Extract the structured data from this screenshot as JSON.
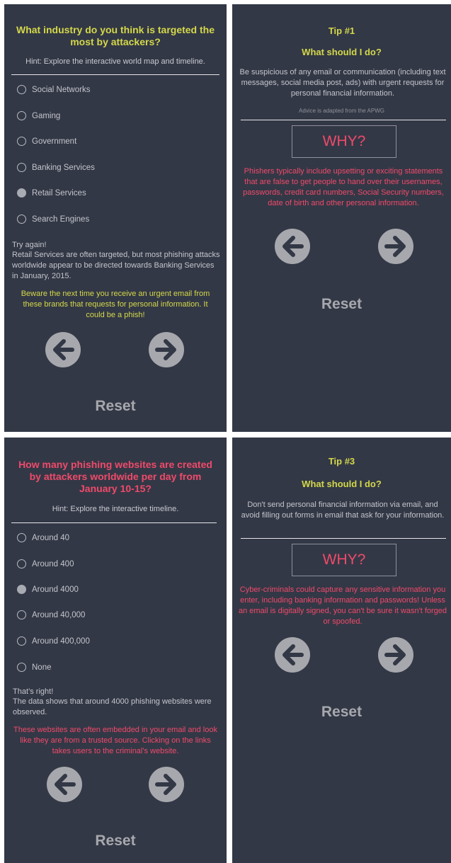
{
  "panel1": {
    "question": "What industry do you think is targeted the most by attackers?",
    "hint": "Hint: Explore the interactive world map and timeline.",
    "options": [
      "Social Networks",
      "Gaming",
      "Government",
      "Banking Services",
      "Retail Services",
      "Search Engines"
    ],
    "selected": "Retail Services",
    "feedback_line1": "Try again!",
    "feedback_body": "Retail Services are often targeted, but most phishing attacks worldwide appear to be directed towards Banking Services in January, 2015.",
    "note": "Beware the next time you receive an urgent email from these brands that requests for personal information. It could be a phish!",
    "reset_label": "Reset"
  },
  "panel2": {
    "tip_number": "Tip #1",
    "tip_title": "What should I do?",
    "tip_body": "Be suspicious of any email or communication (including text messages, social media post, ads) with urgent requests for personal financial information.",
    "advice_note": "Advice is adapted from the APWG",
    "why_label": "WHY?",
    "why_body": "Phishers typically include upsetting or exciting statements that are false to get people to hand over their usernames, passwords, credit card numbers, Social Security numbers, date of birth and other personal information.",
    "reset_label": "Reset"
  },
  "panel3": {
    "question": "How many phishing websites are created by attackers worldwide per day from January 10-15?",
    "hint": "Hint: Explore the interactive timeline.",
    "options": [
      "Around 40",
      "Around 400",
      "Around 4000",
      "Around 40,000",
      "Around 400,000",
      "None"
    ],
    "selected": "Around 4000",
    "feedback_line1": "That’s right!",
    "feedback_body": "The data shows that around 4000 phishing websites were observed.",
    "note": "These websites are often embedded in your email and look like they are from a trusted source. Clicking on the links takes users to the criminal's website.",
    "reset_label": "Reset"
  },
  "panel4": {
    "tip_number": "Tip #3",
    "tip_title": "What should I do?",
    "tip_body": "Don't send personal financial information via email, and avoid filling out forms in email that ask for your information.",
    "why_label": "WHY?",
    "why_body": "Cyber-criminals could capture any sensitive information you enter, including banking information and passwords! Unless an email is digitally signed, you can't be sure it wasn't forged or spoofed.",
    "reset_label": "Reset"
  },
  "colors": {
    "panel_bg": "#333846",
    "yellow_accent": "#d4d84a",
    "red_accent": "#f04a6a",
    "button_gray": "#a7a8ad"
  },
  "icons": {
    "back": "arrow-left-circle-icon",
    "next": "arrow-right-circle-icon",
    "radio": "radio-button-icon"
  }
}
